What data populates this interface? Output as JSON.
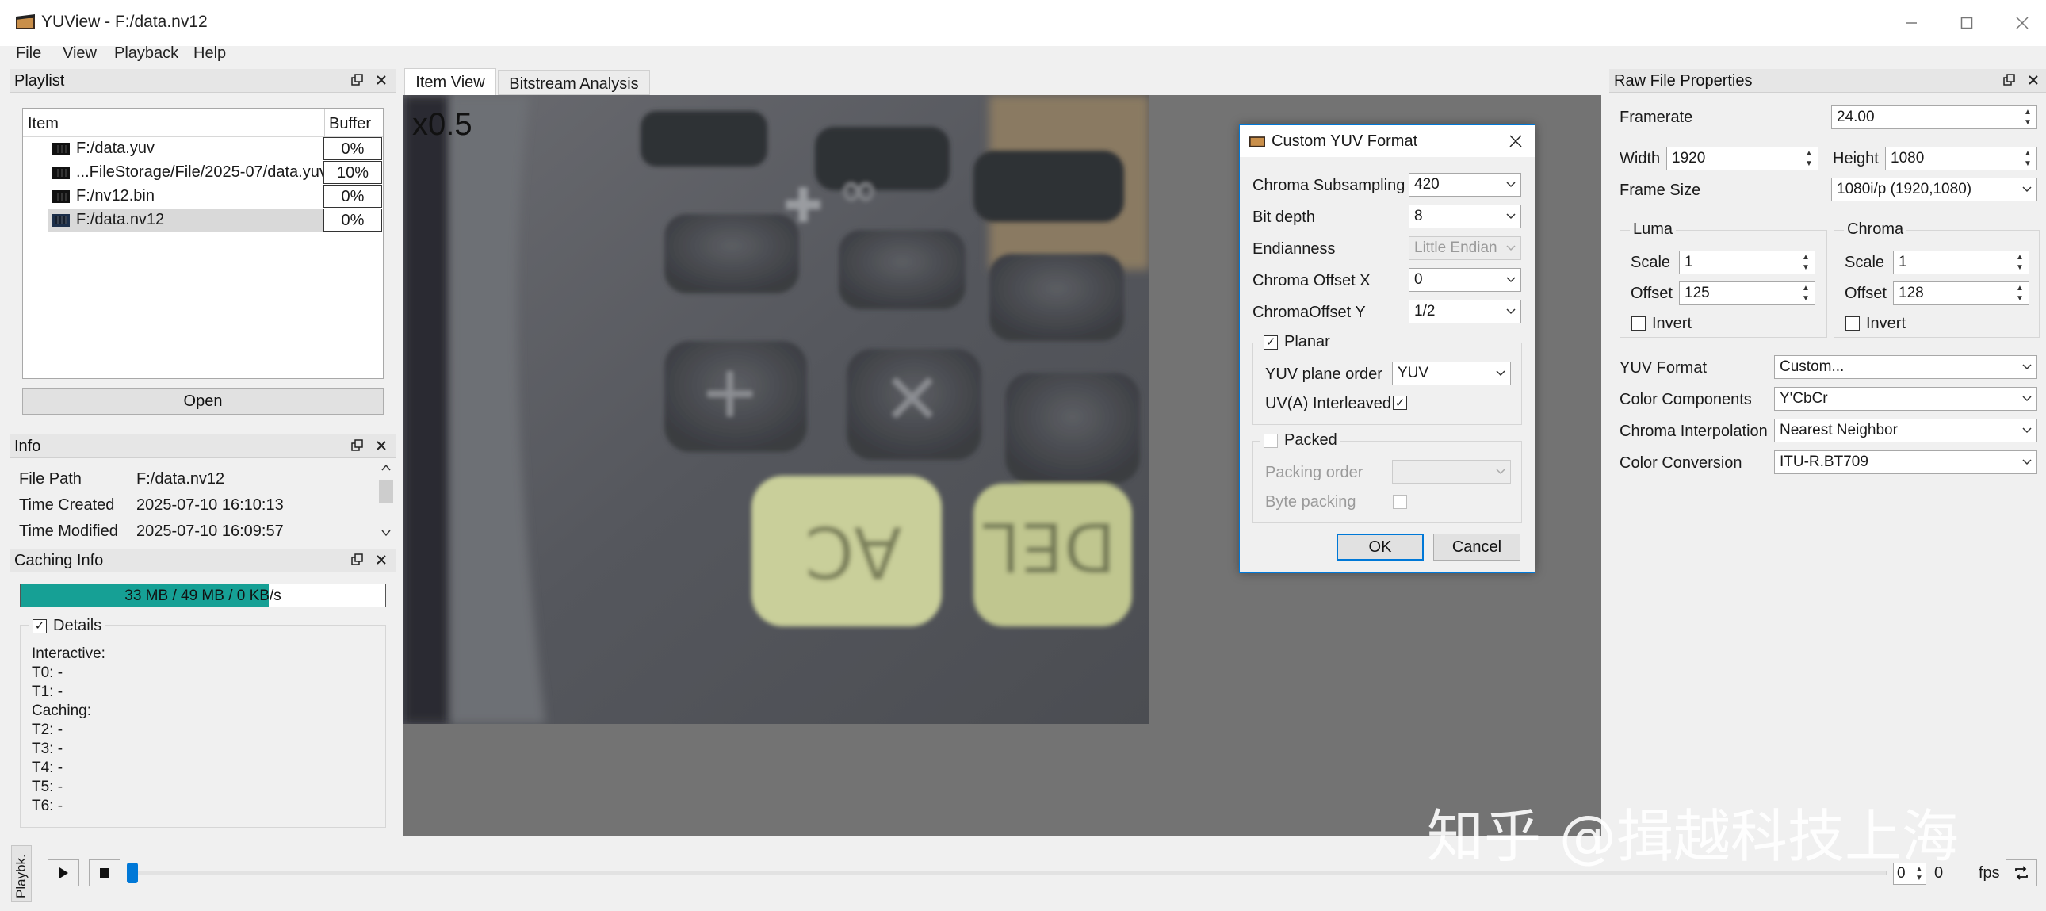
{
  "window": {
    "title": "YUView - F:/data.nv12"
  },
  "menu": [
    "File",
    "View",
    "Playback",
    "Help"
  ],
  "playlist": {
    "title": "Playlist",
    "col_item": "Item",
    "col_buffer": "Buffer",
    "items": [
      {
        "name": "F:/data.yuv",
        "buffer": "0%"
      },
      {
        "name": "...FileStorage/File/2025-07/data.yuv",
        "buffer": "10%"
      },
      {
        "name": "F:/nv12.bin",
        "buffer": "0%"
      },
      {
        "name": "F:/data.nv12",
        "buffer": "0%"
      }
    ],
    "open_label": "Open"
  },
  "info": {
    "title": "Info",
    "rows": [
      {
        "key": "File Path",
        "value": "F:/data.nv12"
      },
      {
        "key": "Time Created",
        "value": "2025-07-10 16:10:13"
      },
      {
        "key": "Time Modified",
        "value": "2025-07-10 16:09:57"
      }
    ]
  },
  "caching": {
    "title": "Caching Info",
    "progress_text": "33 MB / 49 MB / 0 KB/s",
    "progress_fraction": 0.68,
    "details_label": "Details",
    "details_lines": [
      "Interactive:",
      "T0: -",
      "T1: -",
      "Caching:",
      "T2: -",
      "T3: -",
      "T4: -",
      "T5: -",
      "T6: -"
    ]
  },
  "tabs": [
    "Item View",
    "Bitstream Analysis"
  ],
  "viewer": {
    "zoom": "x0.5"
  },
  "dialog": {
    "title": "Custom YUV Format",
    "chroma_subsampling_label": "Chroma Subsampling",
    "chroma_subsampling": "420",
    "bit_depth_label": "Bit depth",
    "bit_depth": "8",
    "endianness_label": "Endianness",
    "endianness": "Little Endian",
    "chroma_offset_x_label": "Chroma Offset X",
    "chroma_offset_x": "0",
    "chroma_offset_y_label": "ChromaOffset Y",
    "chroma_offset_y": "1/2",
    "planar_label": "Planar",
    "plane_order_label": "YUV plane order",
    "plane_order": "YUV",
    "uv_interleaved_label": "UV(A) Interleaved",
    "packed_label": "Packed",
    "packing_order_label": "Packing order",
    "byte_packing_label": "Byte packing",
    "ok_label": "OK",
    "cancel_label": "Cancel"
  },
  "props": {
    "title": "Raw File Properties",
    "framerate_label": "Framerate",
    "framerate": "24.00",
    "width_label": "Width",
    "width": "1920",
    "height_label": "Height",
    "height": "1080",
    "frame_size_label": "Frame Size",
    "frame_size": "1080i/p (1920,1080)",
    "luma_label": "Luma",
    "chroma_label": "Chroma",
    "scale_label": "Scale",
    "offset_label": "Offset",
    "invert_label": "Invert",
    "luma_scale": "1",
    "luma_offset": "125",
    "chroma_scale": "1",
    "chroma_offset": "128",
    "yuv_format_label": "YUV Format",
    "yuv_format": "Custom...",
    "color_components_label": "Color Components",
    "color_components": "Y'CbCr",
    "chroma_interp_label": "Chroma Interpolation",
    "chroma_interp": "Nearest Neighbor",
    "color_conversion_label": "Color Conversion",
    "color_conversion": "ITU-R.BT709"
  },
  "playback": {
    "side_tab": "Playbk.",
    "frame": "0",
    "frame_value": "0",
    "fps_label": "fps"
  },
  "watermark": "知乎 @揖越科技上海"
}
